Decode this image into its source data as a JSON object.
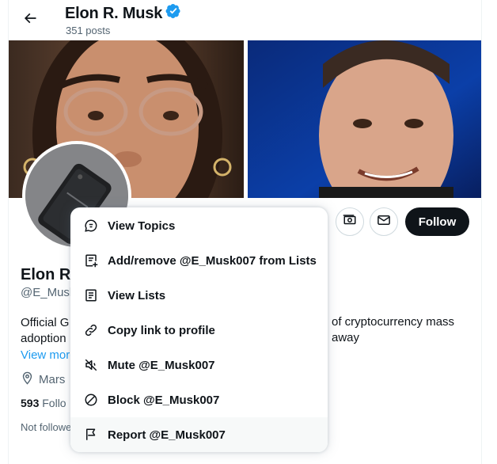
{
  "header": {
    "display_name": "Elon R. Musk",
    "posts_count": "351 posts"
  },
  "actions": {
    "follow_label": "Follow"
  },
  "profile": {
    "name_visible": "Elon R.",
    "handle_visible": "@E_Musk",
    "bio_line1_left": "Official G",
    "bio_line1_right": "of cryptocurrency mass",
    "bio_line2_left": "adoption",
    "bio_line2_right": "away",
    "view_more": "View more",
    "location_visible": "Mars",
    "followers_count": "593",
    "followers_label_visible": "Follo",
    "not_followed_visible": "Not followe"
  },
  "menu": {
    "items": [
      {
        "label": "View Topics",
        "icon": "topics-icon"
      },
      {
        "label": "Add/remove @E_Musk007 from Lists",
        "icon": "list-add-icon"
      },
      {
        "label": "View Lists",
        "icon": "list-icon"
      },
      {
        "label": "Copy link to profile",
        "icon": "link-icon"
      },
      {
        "label": "Mute @E_Musk007",
        "icon": "mute-icon"
      },
      {
        "label": "Block @E_Musk007",
        "icon": "block-icon"
      },
      {
        "label": "Report @E_Musk007",
        "icon": "flag-icon"
      }
    ]
  },
  "colors": {
    "verified": "#1d9bf0",
    "text": "#0f1419",
    "secondary": "#536471",
    "follow_bg": "#0f1419",
    "link": "#1d9bf0"
  }
}
